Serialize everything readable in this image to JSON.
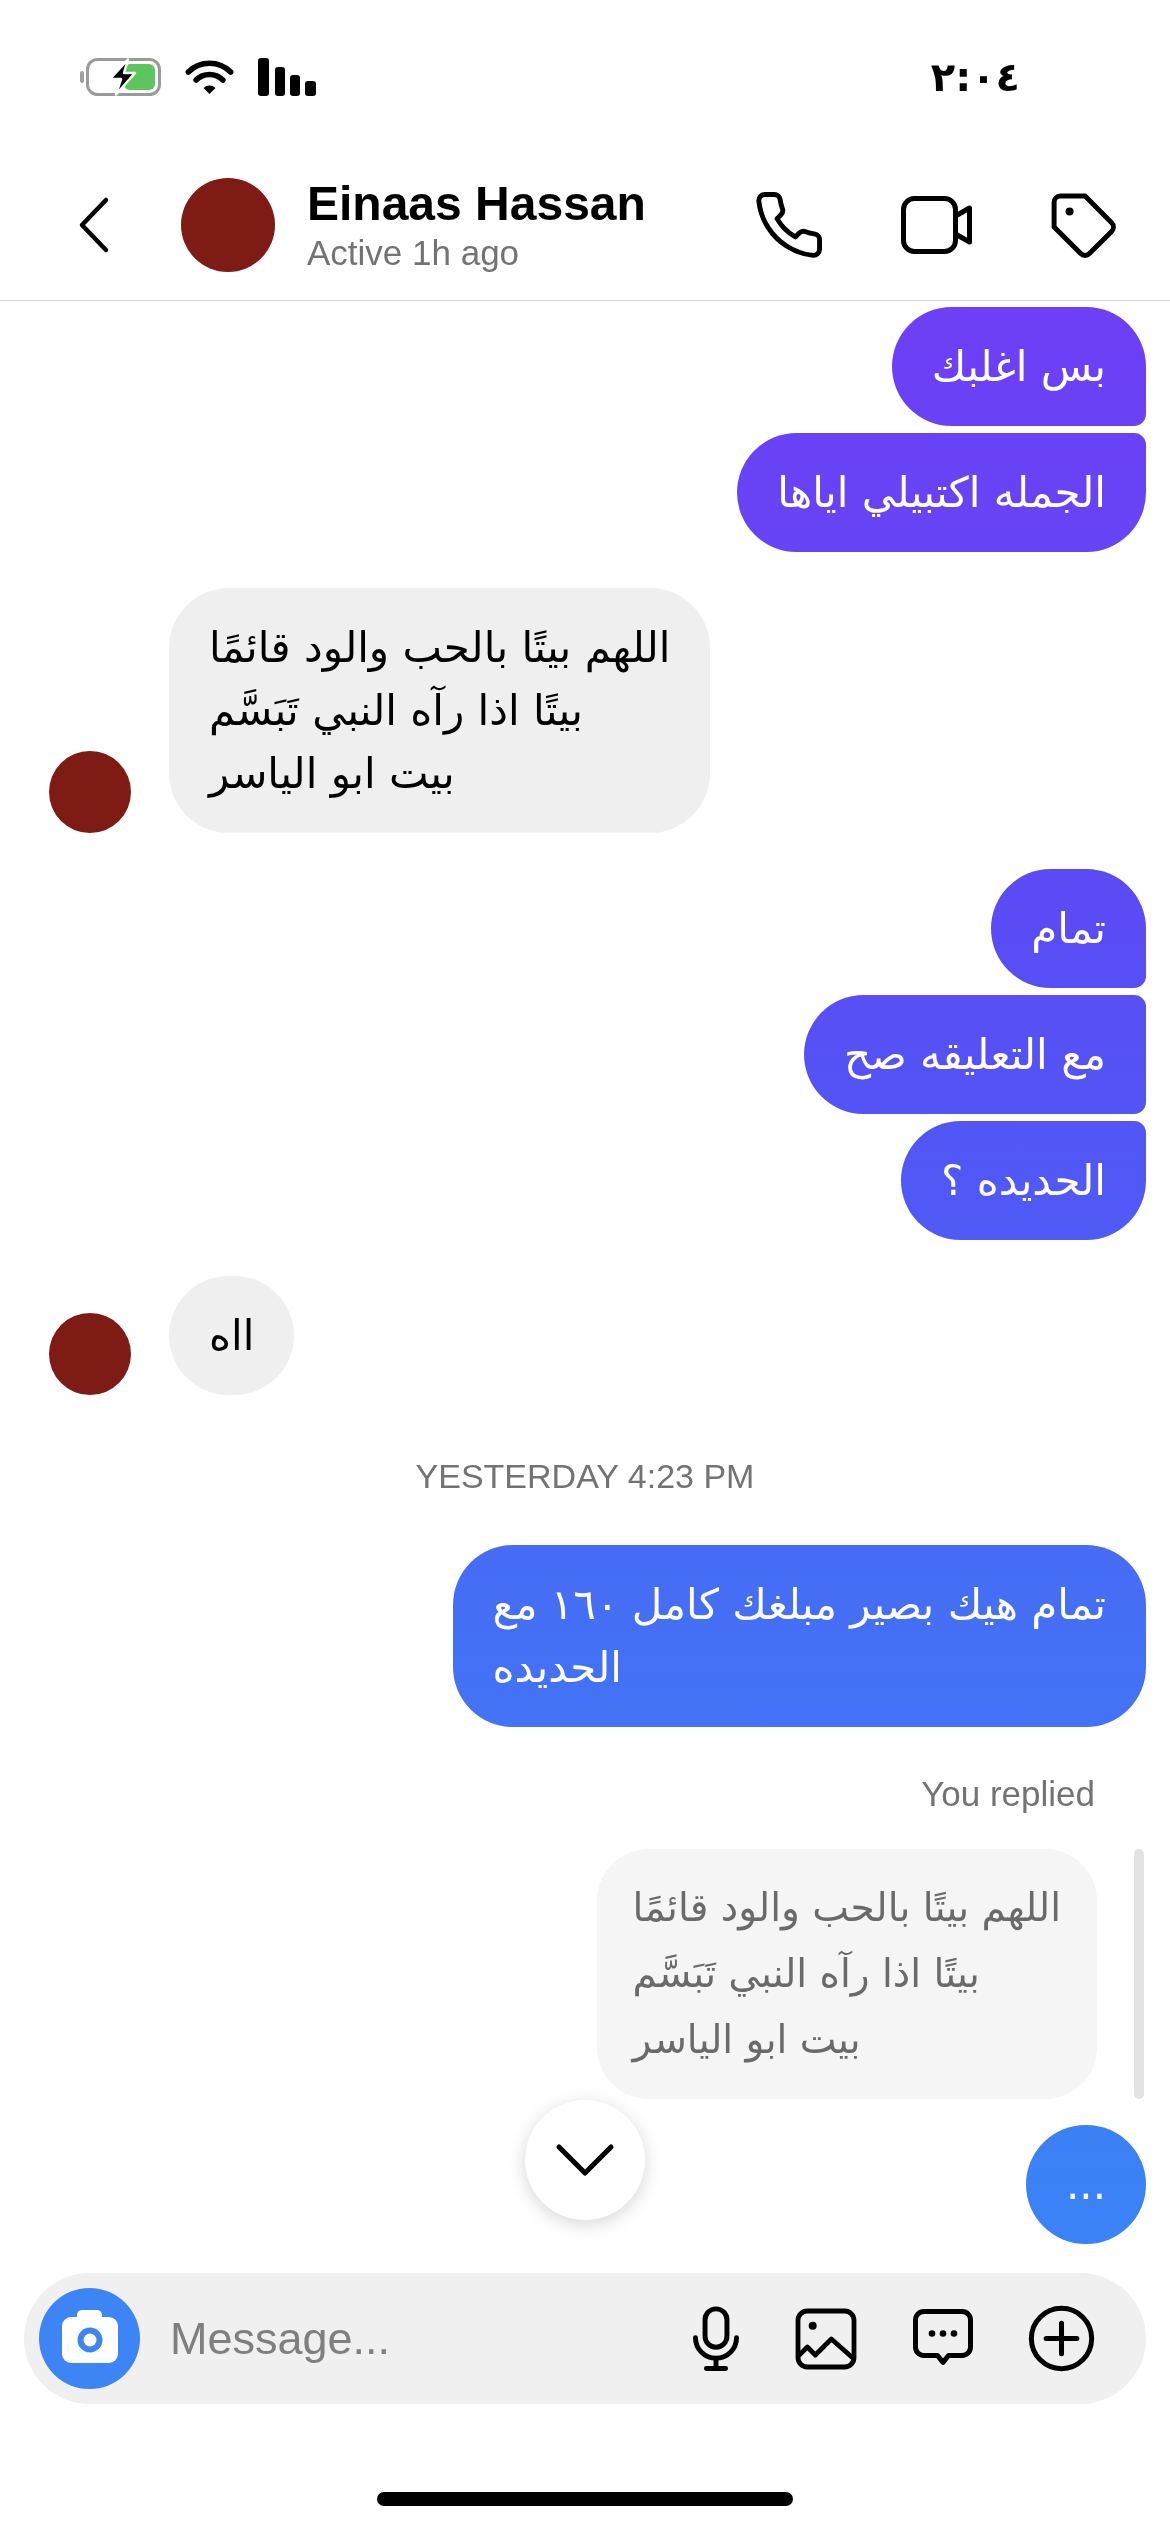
{
  "status_bar": {
    "time": "٢:٠٤"
  },
  "header": {
    "name": "Einaas Hassan",
    "status": "Active 1h ago"
  },
  "messages": [
    {
      "kind": "sent",
      "text": "بس اغلبك"
    },
    {
      "kind": "sent",
      "text": "الجمله اكتبيلي اياها"
    },
    {
      "kind": "received",
      "text": "اللهم بيتًا بالحب والود قائمًا\nبيتًا اذا رآه النبي تَبَسَّم\nبيت ابو الياسر"
    },
    {
      "kind": "sent",
      "text": "تمام"
    },
    {
      "kind": "sent",
      "text": "مع التعليقه صح"
    },
    {
      "kind": "sent",
      "text": "الحديده ؟"
    },
    {
      "kind": "received",
      "text": "ااه"
    },
    {
      "kind": "timestamp",
      "text": "YESTERDAY 4:23 PM"
    },
    {
      "kind": "sent",
      "text": "تمام هيك بصير مبلغك كامل ١٦٠ مع\nالحديده"
    },
    {
      "kind": "reply",
      "label": "You replied",
      "text": "اللهم بيتًا بالحب والود قائمًا\nبيتًا اذا رآه النبي تَبَسَّم\nبيت ابو الياسر"
    },
    {
      "kind": "sent",
      "text": "..."
    }
  ],
  "composer": {
    "placeholder": "Message..."
  }
}
